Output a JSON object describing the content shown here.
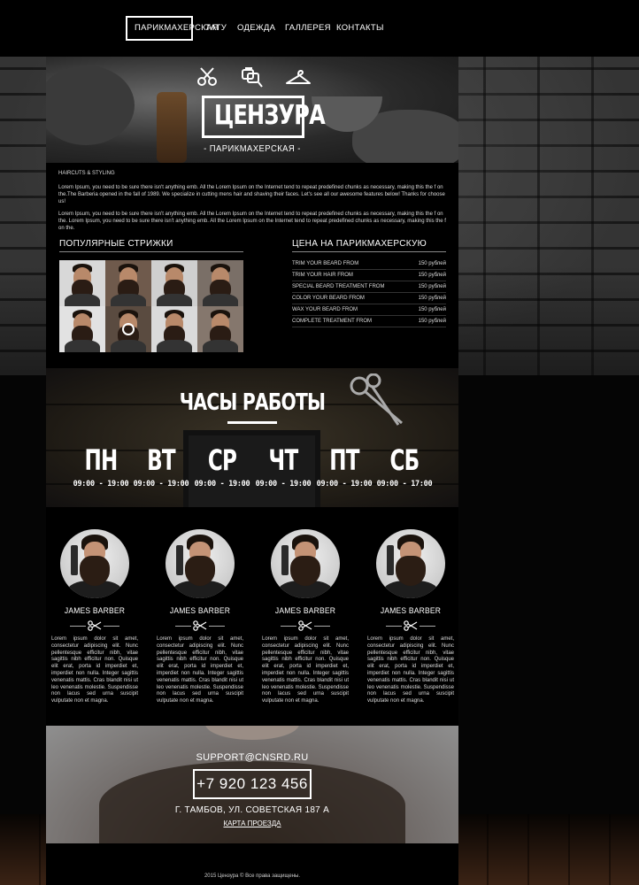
{
  "nav": {
    "items": [
      {
        "label": "ПАРИКМАХЕРСКАЯ",
        "active": true
      },
      {
        "label": "ТАТУ"
      },
      {
        "label": "ОДЕЖДА"
      },
      {
        "label": "ГАЛЛЕРЕЯ"
      },
      {
        "label": "КОНТАКТЫ"
      }
    ]
  },
  "hero": {
    "logo": "ЦЕНЗУРА",
    "subtitle": "- ПАРИКМАХЕРСКАЯ -",
    "icons": [
      "scissors-icon",
      "tattoo-machine-icon",
      "hanger-icon"
    ]
  },
  "intro": {
    "heading": "HAIRCUTS & STYLING",
    "p1": "Lorem Ipsum, you need to be sure there isn't anything emb. All the Lorem Ipsum on the Internet tend to repeat predefined chunks as necessary, making this the f on the.The Barberia opened in the fall of 1989. We specialize in cutting mens hair and shaving their faces. Let's see all our awesome features below! Thanks for choose us!",
    "p2": "Lorem Ipsum, you need to be sure there isn't anything emb. All the Lorem Ipsum on the Internet tend to repeat predefined chunks as necessary, making this the f on the. Lorem Ipsum, you need to be sure there isn't anything emb. All the Lorem Ipsum on the Internet tend to repeat predefined chunks as necessary, making this the f on the."
  },
  "popular": {
    "title": "ПОПУЛЯРНЫЕ СТРИЖКИ"
  },
  "prices": {
    "title": "ЦЕНА НА ПАРИКМАХЕРСКУЮ",
    "rows": [
      {
        "service": "TRIM YOUR BEARD FROM",
        "price": "150 рублей"
      },
      {
        "service": "TRIM YOUR HAIR FROM",
        "price": "150 рублей"
      },
      {
        "service": "SPECIAL BEARD TREATMENT FROM",
        "price": "150 рублей"
      },
      {
        "service": "COLOR YOUR BEARD FROM",
        "price": "150 рублей"
      },
      {
        "service": "WAX YOUR BEARD FROM",
        "price": "150 рублей"
      },
      {
        "service": "COMPLETE TREATMENT FROM",
        "price": "150 рублей"
      }
    ]
  },
  "hours": {
    "title": "ЧАСЫ РАБОТЫ",
    "days": [
      {
        "name": "ПН",
        "time": "09:00 - 19:00"
      },
      {
        "name": "ВТ",
        "time": "09:00 - 19:00"
      },
      {
        "name": "СР",
        "time": "09:00 - 19:00"
      },
      {
        "name": "ЧТ",
        "time": "09:00 - 19:00"
      },
      {
        "name": "ПТ",
        "time": "09:00 - 19:00"
      },
      {
        "name": "СБ",
        "time": "09:00 - 17:00"
      }
    ]
  },
  "barbers": [
    {
      "name": "JAMES BARBER",
      "text": "Lorem ipsum dolor sit amet, consectetur adipiscing elit. Nunc pellentesque efficitur nibh, vitae sagittis nibh efficitur non. Quisque elit erat, porta id imperdiet et, imperdiet non nulla. Integer sagittis venenatis mattis. Cras blandit nisi ut leo venenatis molestie. Suspendisse non lacus sed urna suscipit vulputate non et magna."
    },
    {
      "name": "JAMES BARBER",
      "text": "Lorem ipsum dolor sit amet, consectetur adipiscing elit. Nunc pellentesque efficitur nibh, vitae sagittis nibh efficitur non. Quisque elit erat, porta id imperdiet et, imperdiet non nulla. Integer sagittis venenatis mattis. Cras blandit nisi ut leo venenatis molestie. Suspendisse non lacus sed urna suscipit vulputate non et magna."
    },
    {
      "name": "JAMES BARBER",
      "text": "Lorem ipsum dolor sit amet, consectetur adipiscing elit. Nunc pellentesque efficitur nibh, vitae sagittis nibh efficitur non. Quisque elit erat, porta id imperdiet et, imperdiet non nulla. Integer sagittis venenatis mattis. Cras blandit nisi ut leo venenatis molestie. Suspendisse non lacus sed urna suscipit vulputate non et magna."
    },
    {
      "name": "JAMES BARBER",
      "text": "Lorem ipsum dolor sit amet, consectetur adipiscing elit. Nunc pellentesque efficitur nibh, vitae sagittis nibh efficitur non. Quisque elit erat, porta id imperdiet et, imperdiet non nulla. Integer sagittis venenatis mattis. Cras blandit nisi ut leo venenatis molestie. Suspendisse non lacus sed urna suscipit vulputate non et magna."
    }
  ],
  "contact": {
    "email": "SUPPORT@CNSRD.RU",
    "phone": "+7 920 123 456",
    "address": "Г. ТАМБОВ, УЛ. СОВЕТСКАЯ 187 А",
    "map_link": "КАРТА ПРОЕЗДА"
  },
  "footer": {
    "copyright": "2015 Цензура © Все права защищены."
  },
  "colors": {
    "background": "#000000",
    "text": "#ffffff"
  }
}
